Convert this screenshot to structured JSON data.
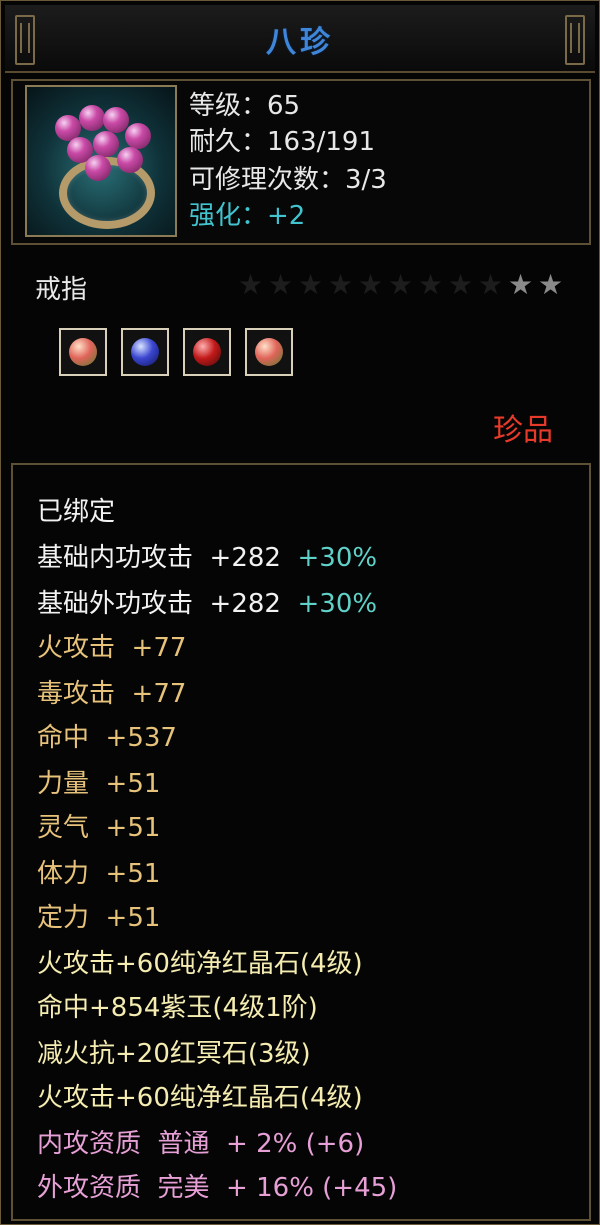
{
  "window": {
    "title": "八珍"
  },
  "item": {
    "level_label": "等级：65",
    "durability_label": "耐久：163/191",
    "repair_label": "可修理次数：3/3",
    "enhance_label": "强化：+2",
    "type": "戒指",
    "stars_filled": 2,
    "stars_total": 11,
    "rarity": "珍品",
    "gems": [
      "red-pink-gem-icon",
      "blue-gem-icon",
      "red-gem-icon",
      "red-pink-gem-icon"
    ]
  },
  "stats": {
    "bound": "已绑定",
    "base_inner_label": "基础内功攻击",
    "base_inner_value": "+282",
    "base_inner_bonus": "+30%",
    "base_outer_label": "基础外功攻击",
    "base_outer_value": "+282",
    "base_outer_bonus": "+30%",
    "fire_atk": "火攻击  +77",
    "poison_atk": "毒攻击  +77",
    "hit": "命中  +537",
    "strength": "力量  +51",
    "spirit": "灵气  +51",
    "stamina": "体力  +51",
    "focus": "定力  +51",
    "socket1": "火攻击+60纯净红晶石(4级)",
    "socket2": "命中+854紫玉(4级1阶)",
    "socket3": "减火抗+20红冥石(3级)",
    "socket4": "火攻击+60纯净红晶石(4级)",
    "inner_quality": "内攻资质  普通  + 2% (+6)",
    "outer_quality": "外攻资质  完美  + 16% (+45)"
  }
}
